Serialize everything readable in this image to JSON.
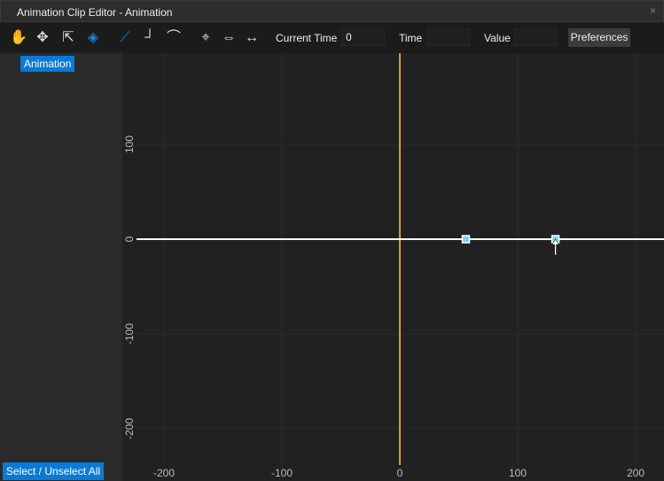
{
  "window": {
    "title": "Animation Clip Editor - Animation",
    "close": "×"
  },
  "toolbar": {
    "icons": [
      "hand-icon",
      "move-icon",
      "scale-icon",
      "keyframe-icon",
      "linear-icon",
      "step-icon",
      "bezier-icon",
      "center-icon",
      "fit-icon",
      "expand-icon"
    ],
    "current_time_label": "Current Time",
    "current_time_value": "0",
    "time_label": "Time",
    "time_value": "",
    "value_label": "Value",
    "value_value": "",
    "preferences": "Preferences"
  },
  "sidebar": {
    "track": "Animation",
    "select_all": "Select / Unselect All"
  },
  "chart_data": {
    "type": "line",
    "x_ticks": [
      "-200",
      "-100",
      "0",
      "100",
      "200"
    ],
    "y_ticks": [
      "100",
      "0",
      "-100",
      "-200"
    ],
    "xlim": [
      -220,
      225
    ],
    "ylim": [
      -235,
      155
    ],
    "series": [
      {
        "name": "Animation",
        "values": [
          [
            -225,
            0
          ],
          [
            56,
            0
          ],
          [
            132,
            0
          ],
          [
            225,
            0
          ]
        ]
      }
    ],
    "keyframes": [
      [
        56,
        0
      ],
      [
        132,
        0
      ]
    ],
    "current_time": 0,
    "colors": {
      "curve": "#ffffff",
      "time_marker": "#d89a2c",
      "key": "#6fd8f0"
    }
  }
}
